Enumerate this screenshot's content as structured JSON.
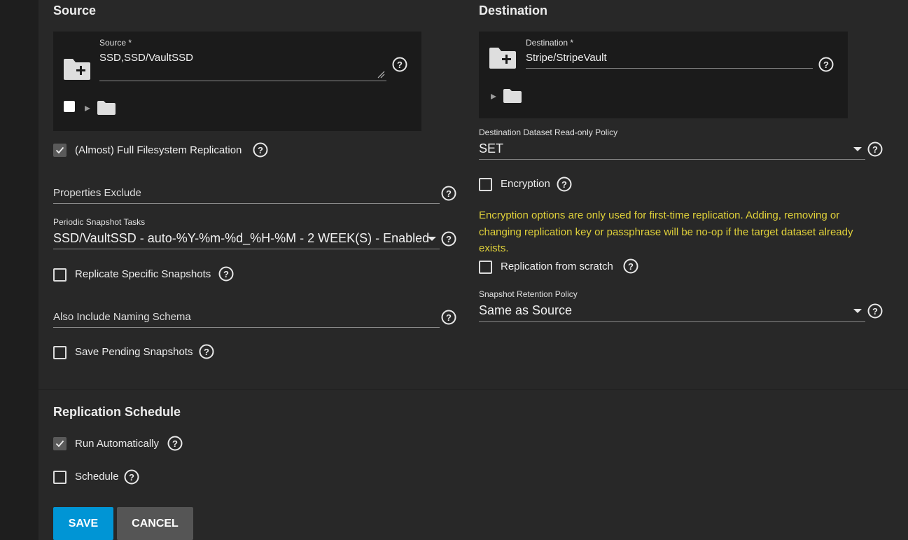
{
  "source": {
    "heading": "Source",
    "field_label": "Source *",
    "field_value": "SSD,SSD/VaultSSD",
    "full_fs_label": "(Almost) Full Filesystem Replication",
    "full_fs_checked": true,
    "properties_exclude_label": "Properties Exclude",
    "periodic_label": "Periodic Snapshot Tasks",
    "periodic_value": "SSD/VaultSSD - auto-%Y-%m-%d_%H-%M - 2 WEEK(S) - Enabled",
    "replicate_specific_label": "Replicate Specific Snapshots",
    "naming_schema_label": "Also Include Naming Schema",
    "save_pending_label": "Save Pending Snapshots"
  },
  "destination": {
    "heading": "Destination",
    "field_label": "Destination *",
    "field_value": "Stripe/StripeVault",
    "readonly_label": "Destination Dataset Read-only Policy",
    "readonly_value": "SET",
    "encryption_label": "Encryption",
    "warning": "Encryption options are only used for first-time replication. Adding, removing or changing replication key or passphrase will be no-op if the target dataset already exists.",
    "scratch_label": "Replication from scratch",
    "retention_label": "Snapshot Retention Policy",
    "retention_value": "Same as Source"
  },
  "schedule": {
    "heading": "Replication Schedule",
    "run_auto_label": "Run Automatically",
    "run_auto_checked": true,
    "schedule_label": "Schedule"
  },
  "actions": {
    "save_label": "SAVE",
    "cancel_label": "CANCEL"
  },
  "colors": {
    "accent": "#0095d5",
    "warning": "#e0d13a",
    "panel": "#282828",
    "tree_bg": "#1b1b1b"
  }
}
